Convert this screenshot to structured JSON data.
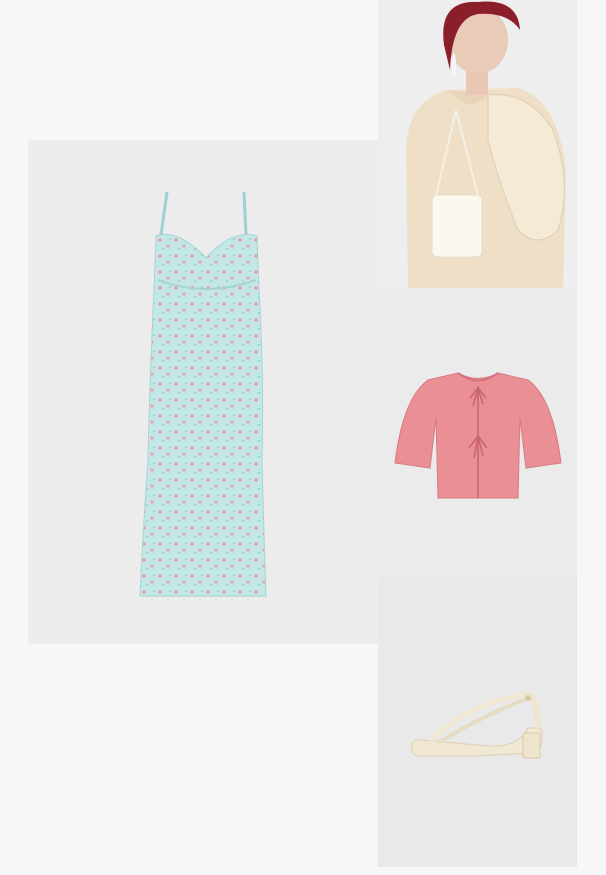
{
  "collage": {
    "background": "#f7f7f7",
    "items": [
      {
        "id": "dress",
        "icon": "floral-slip-dress",
        "accent": "#bfe3e3",
        "pattern": "#e59ab0"
      },
      {
        "id": "model",
        "icon": "model-with-crochet-bag",
        "accent": "#efe2c8",
        "hair": "#8a1f2b"
      },
      {
        "id": "cardigan",
        "icon": "pink-tie-cardigan",
        "accent": "#e98f95"
      },
      {
        "id": "sandal",
        "icon": "cream-strappy-sandal",
        "accent": "#f1e8d3"
      }
    ]
  }
}
